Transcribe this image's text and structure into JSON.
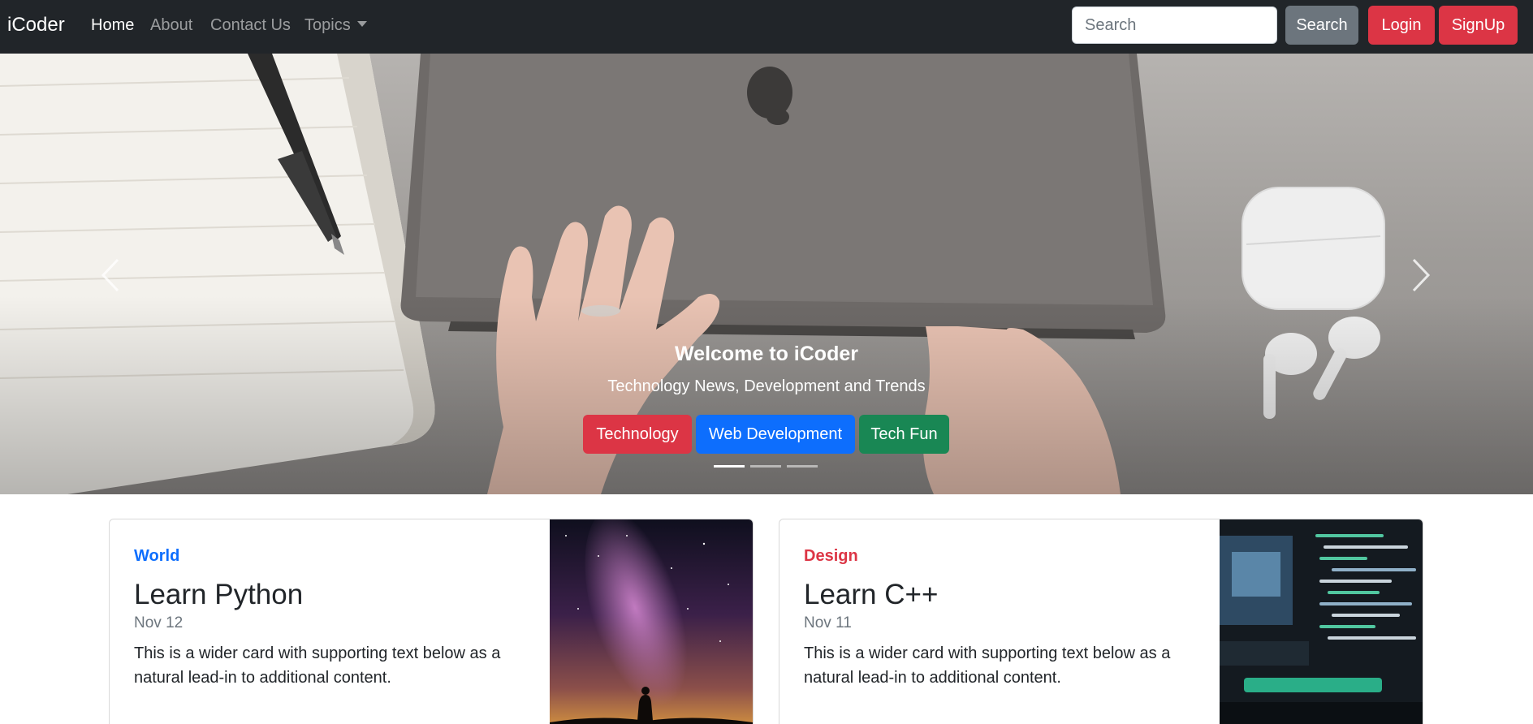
{
  "navbar": {
    "brand": "iCoder",
    "links": [
      "Home",
      "About",
      "Contact Us",
      "Topics"
    ],
    "active": "Home",
    "search_placeholder": "Search",
    "search_button": "Search",
    "login_button": "Login",
    "signup_button": "SignUp"
  },
  "hero": {
    "title": "Welcome to iCoder",
    "subtitle": "Technology News, Development and Trends",
    "buttons": [
      "Technology",
      "Web Development",
      "Tech Fun"
    ],
    "active_slide": 1,
    "slide_count": 3
  },
  "cards": [
    {
      "category": "World",
      "title": "Learn Python",
      "date": "Nov 12",
      "text": "This is a wider card with supporting text below as a natural lead-in to additional content."
    },
    {
      "category": "Design",
      "title": "Learn C++",
      "date": "Nov 11",
      "text": "This is a wider card with supporting text below as a natural lead-in to additional content."
    }
  ],
  "colors": {
    "navbar_bg": "#212529",
    "danger": "#dc3545",
    "primary": "#0d6efd",
    "success": "#198754",
    "secondary": "#6c757d"
  }
}
